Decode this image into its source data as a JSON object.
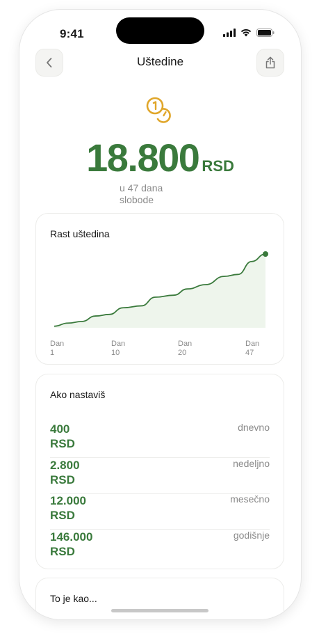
{
  "status": {
    "time": "9:41"
  },
  "nav": {
    "title": "Uštedine",
    "back_icon": "chevron-left-icon",
    "share_icon": "share-icon"
  },
  "hero": {
    "icon": "coins-icon",
    "amount": "18.800",
    "currency": "RSD",
    "subtitle": "u 47 dana slobode"
  },
  "colors": {
    "accent": "#3a7a3c",
    "accent_fill": "#eef5ec",
    "coin": "#e0a62a",
    "muted": "#8a8a8a"
  },
  "chart_card": {
    "title": "Rast uštedina",
    "x_ticks": [
      {
        "line1": "Dan",
        "line2": "1"
      },
      {
        "line1": "Dan",
        "line2": "10"
      },
      {
        "line1": "Dan",
        "line2": "20"
      },
      {
        "line1": "Dan",
        "line2": "47"
      }
    ]
  },
  "chart_data": {
    "type": "area",
    "x": [
      1,
      4,
      7,
      10,
      13,
      16,
      20,
      23,
      27,
      30,
      34,
      38,
      41,
      44,
      47
    ],
    "values": [
      400,
      1200,
      1600,
      3000,
      3400,
      5100,
      5600,
      7800,
      8300,
      9900,
      11000,
      13100,
      13600,
      16900,
      18800
    ],
    "xlim": [
      1,
      47
    ],
    "ylim": [
      0,
      18800
    ],
    "grid": false,
    "end_marker": true
  },
  "projection_card": {
    "title": "Ako nastaviš",
    "rows": [
      {
        "value": "400",
        "currency": "RSD",
        "period": "dnevno"
      },
      {
        "value": "2.800",
        "currency": "RSD",
        "period": "nedeljno"
      },
      {
        "value": "12.000",
        "currency": "RSD",
        "period": "mesečno"
      },
      {
        "value": "146.000",
        "currency": "RSD",
        "period": "godišnje"
      }
    ]
  },
  "comparison_card": {
    "title": "To je kao..."
  }
}
